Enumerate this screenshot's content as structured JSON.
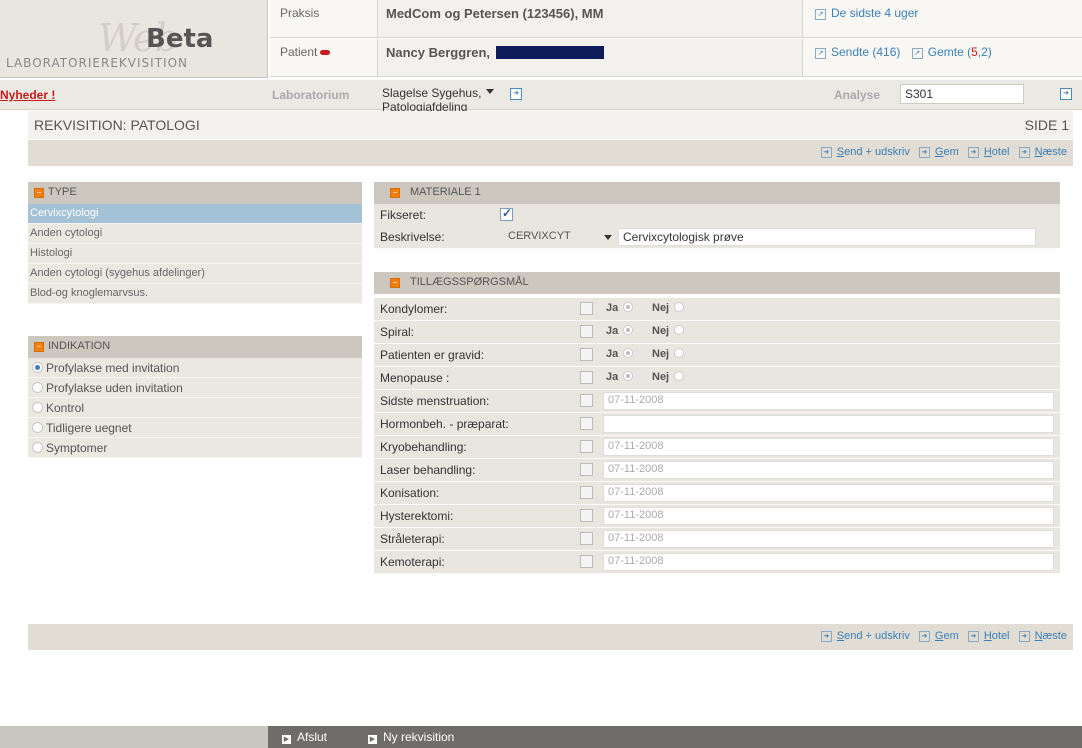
{
  "logo": {
    "word": "Web",
    "beta": "Beta",
    "subtitle": "LABORATORIEREKVISITION"
  },
  "header": {
    "praksis_label": "Praksis",
    "praksis_value": "MedCom og Petersen (123456), MM",
    "patient_label": "Patient",
    "patient_value": "Nancy Berggren,",
    "link_recent": "De sidste 4 uger",
    "link_sent": "Sendte (416)",
    "link_saved_prefix": "Gemte (",
    "link_saved_count": "5",
    "link_saved_suffix": ",2)"
  },
  "bar": {
    "news": "Nyheder !",
    "lab_label": "Laboratorium",
    "lab_value": "Slagelse Sygehus, Patologiafdeling",
    "analysis_label": "Analyse",
    "analysis_value": "S301"
  },
  "title": {
    "requisition": "REKVISITION: PATOLOGI",
    "page": "SIDE 1"
  },
  "actions": {
    "send_first": "S",
    "send_rest": "end + udskriv",
    "save_first": "G",
    "save_rest": "em",
    "hotel_first": "H",
    "hotel_rest": "otel",
    "next_first": "N",
    "next_rest": "æste"
  },
  "type_section": {
    "heading": "TYPE",
    "items": [
      "Cervixcytologi",
      "Anden cytologi",
      "Histologi",
      "Anden cytologi (sygehus afdelinger)",
      "Blod-og knoglemarvsus."
    ]
  },
  "indication_section": {
    "heading": "INDIKATION",
    "items": [
      "Profylakse med invitation",
      "Profylakse uden invitation",
      "Kontrol",
      "Tidligere uegnet",
      "Symptomer"
    ]
  },
  "material": {
    "heading": "MATERIALE 1",
    "fixed_label": "Fikseret:",
    "desc_label": "Beskrivelse:",
    "desc_code": "CERVIXCYT",
    "desc_text": "Cervixcytologisk prøve"
  },
  "extra": {
    "heading": "TILLÆGSSPØRGSMÅL",
    "yes": "Ja",
    "no": "Nej",
    "yn_rows": [
      "Kondylomer:",
      "Spiral:",
      "Patienten er gravid:",
      "Menopause :"
    ],
    "date_rows": [
      {
        "label": "Sidste menstruation:",
        "value": "07-11-2008"
      },
      {
        "label": "Hormonbeh. - præparat:",
        "value": ""
      },
      {
        "label": "Kryobehandling:",
        "value": "07-11-2008"
      },
      {
        "label": "Laser behandling:",
        "value": "07-11-2008"
      },
      {
        "label": "Konisation:",
        "value": "07-11-2008"
      },
      {
        "label": "Hysterektomi:",
        "value": "07-11-2008"
      },
      {
        "label": "Stråleterapi:",
        "value": "07-11-2008"
      },
      {
        "label": "Kemoterapi:",
        "value": "07-11-2008"
      }
    ]
  },
  "footer": {
    "exit": "Afslut",
    "new": "Ny rekvisition"
  },
  "colors": {
    "link": "#3b7fb6",
    "accent_orange": "#f07f10",
    "selected_row": "#a4c2d5",
    "news_red": "#c81a1a"
  }
}
